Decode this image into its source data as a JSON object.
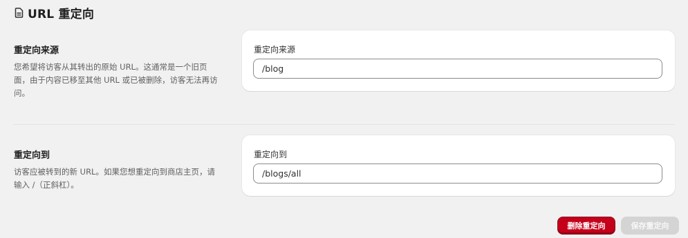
{
  "header": {
    "icon": "file-icon",
    "title": "URL 重定向"
  },
  "from_section": {
    "heading": "重定向来源",
    "description": "您希望将访客从其转出的原始 URL。这通常是一个旧页面，由于内容已移至其他 URL 或已被删除，访客无法再访问。",
    "field_label": "重定向来源",
    "field_value": "/blog"
  },
  "to_section": {
    "heading": "重定向到",
    "description": "访客应被转到的新 URL。如果您想重定向到商店主页，请输入 /（正斜杠）。",
    "field_label": "重定向到",
    "field_value": "/blogs/all"
  },
  "actions": {
    "delete_label": "删除重定向",
    "save_label": "保存重定向"
  },
  "colors": {
    "background": "#f1f1f1",
    "danger": "#c4001a",
    "disabled": "#d4d4d4"
  }
}
